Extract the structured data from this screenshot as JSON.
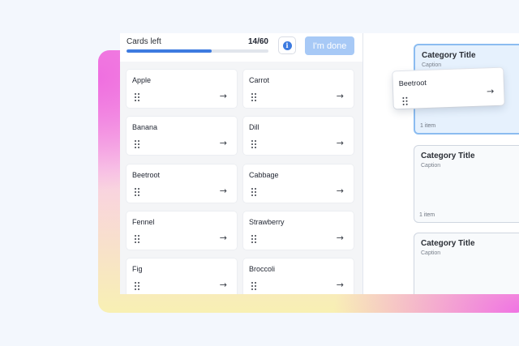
{
  "header": {
    "cards_left_label": "Cards left",
    "count_text": "14/60",
    "progress_fraction": 0.6,
    "done_label": "I'm done",
    "info_glyph": "i"
  },
  "cards": [
    {
      "label": "Apple"
    },
    {
      "label": "Carrot"
    },
    {
      "label": "Banana"
    },
    {
      "label": "Dill"
    },
    {
      "label": "Beetroot"
    },
    {
      "label": "Cabbage"
    },
    {
      "label": "Fennel"
    },
    {
      "label": "Strawberry"
    },
    {
      "label": "Fig"
    },
    {
      "label": "Broccoli"
    }
  ],
  "dragging_card": {
    "label": "Beetroot"
  },
  "categories": [
    {
      "title": "Category Title",
      "caption": "Caption",
      "count": "1 item"
    },
    {
      "title": "Category Title",
      "caption": "Caption",
      "count": "1 item"
    },
    {
      "title": "Category Title",
      "caption": "Caption",
      "count": ""
    }
  ],
  "icons": {
    "grip": "drag-handle-icon",
    "arrow": "arrow-right-icon",
    "info": "info-icon"
  },
  "colors": {
    "accent": "#3d7be0",
    "done_disabled": "#a7c9f6",
    "active_category": "#8bbcf0"
  }
}
